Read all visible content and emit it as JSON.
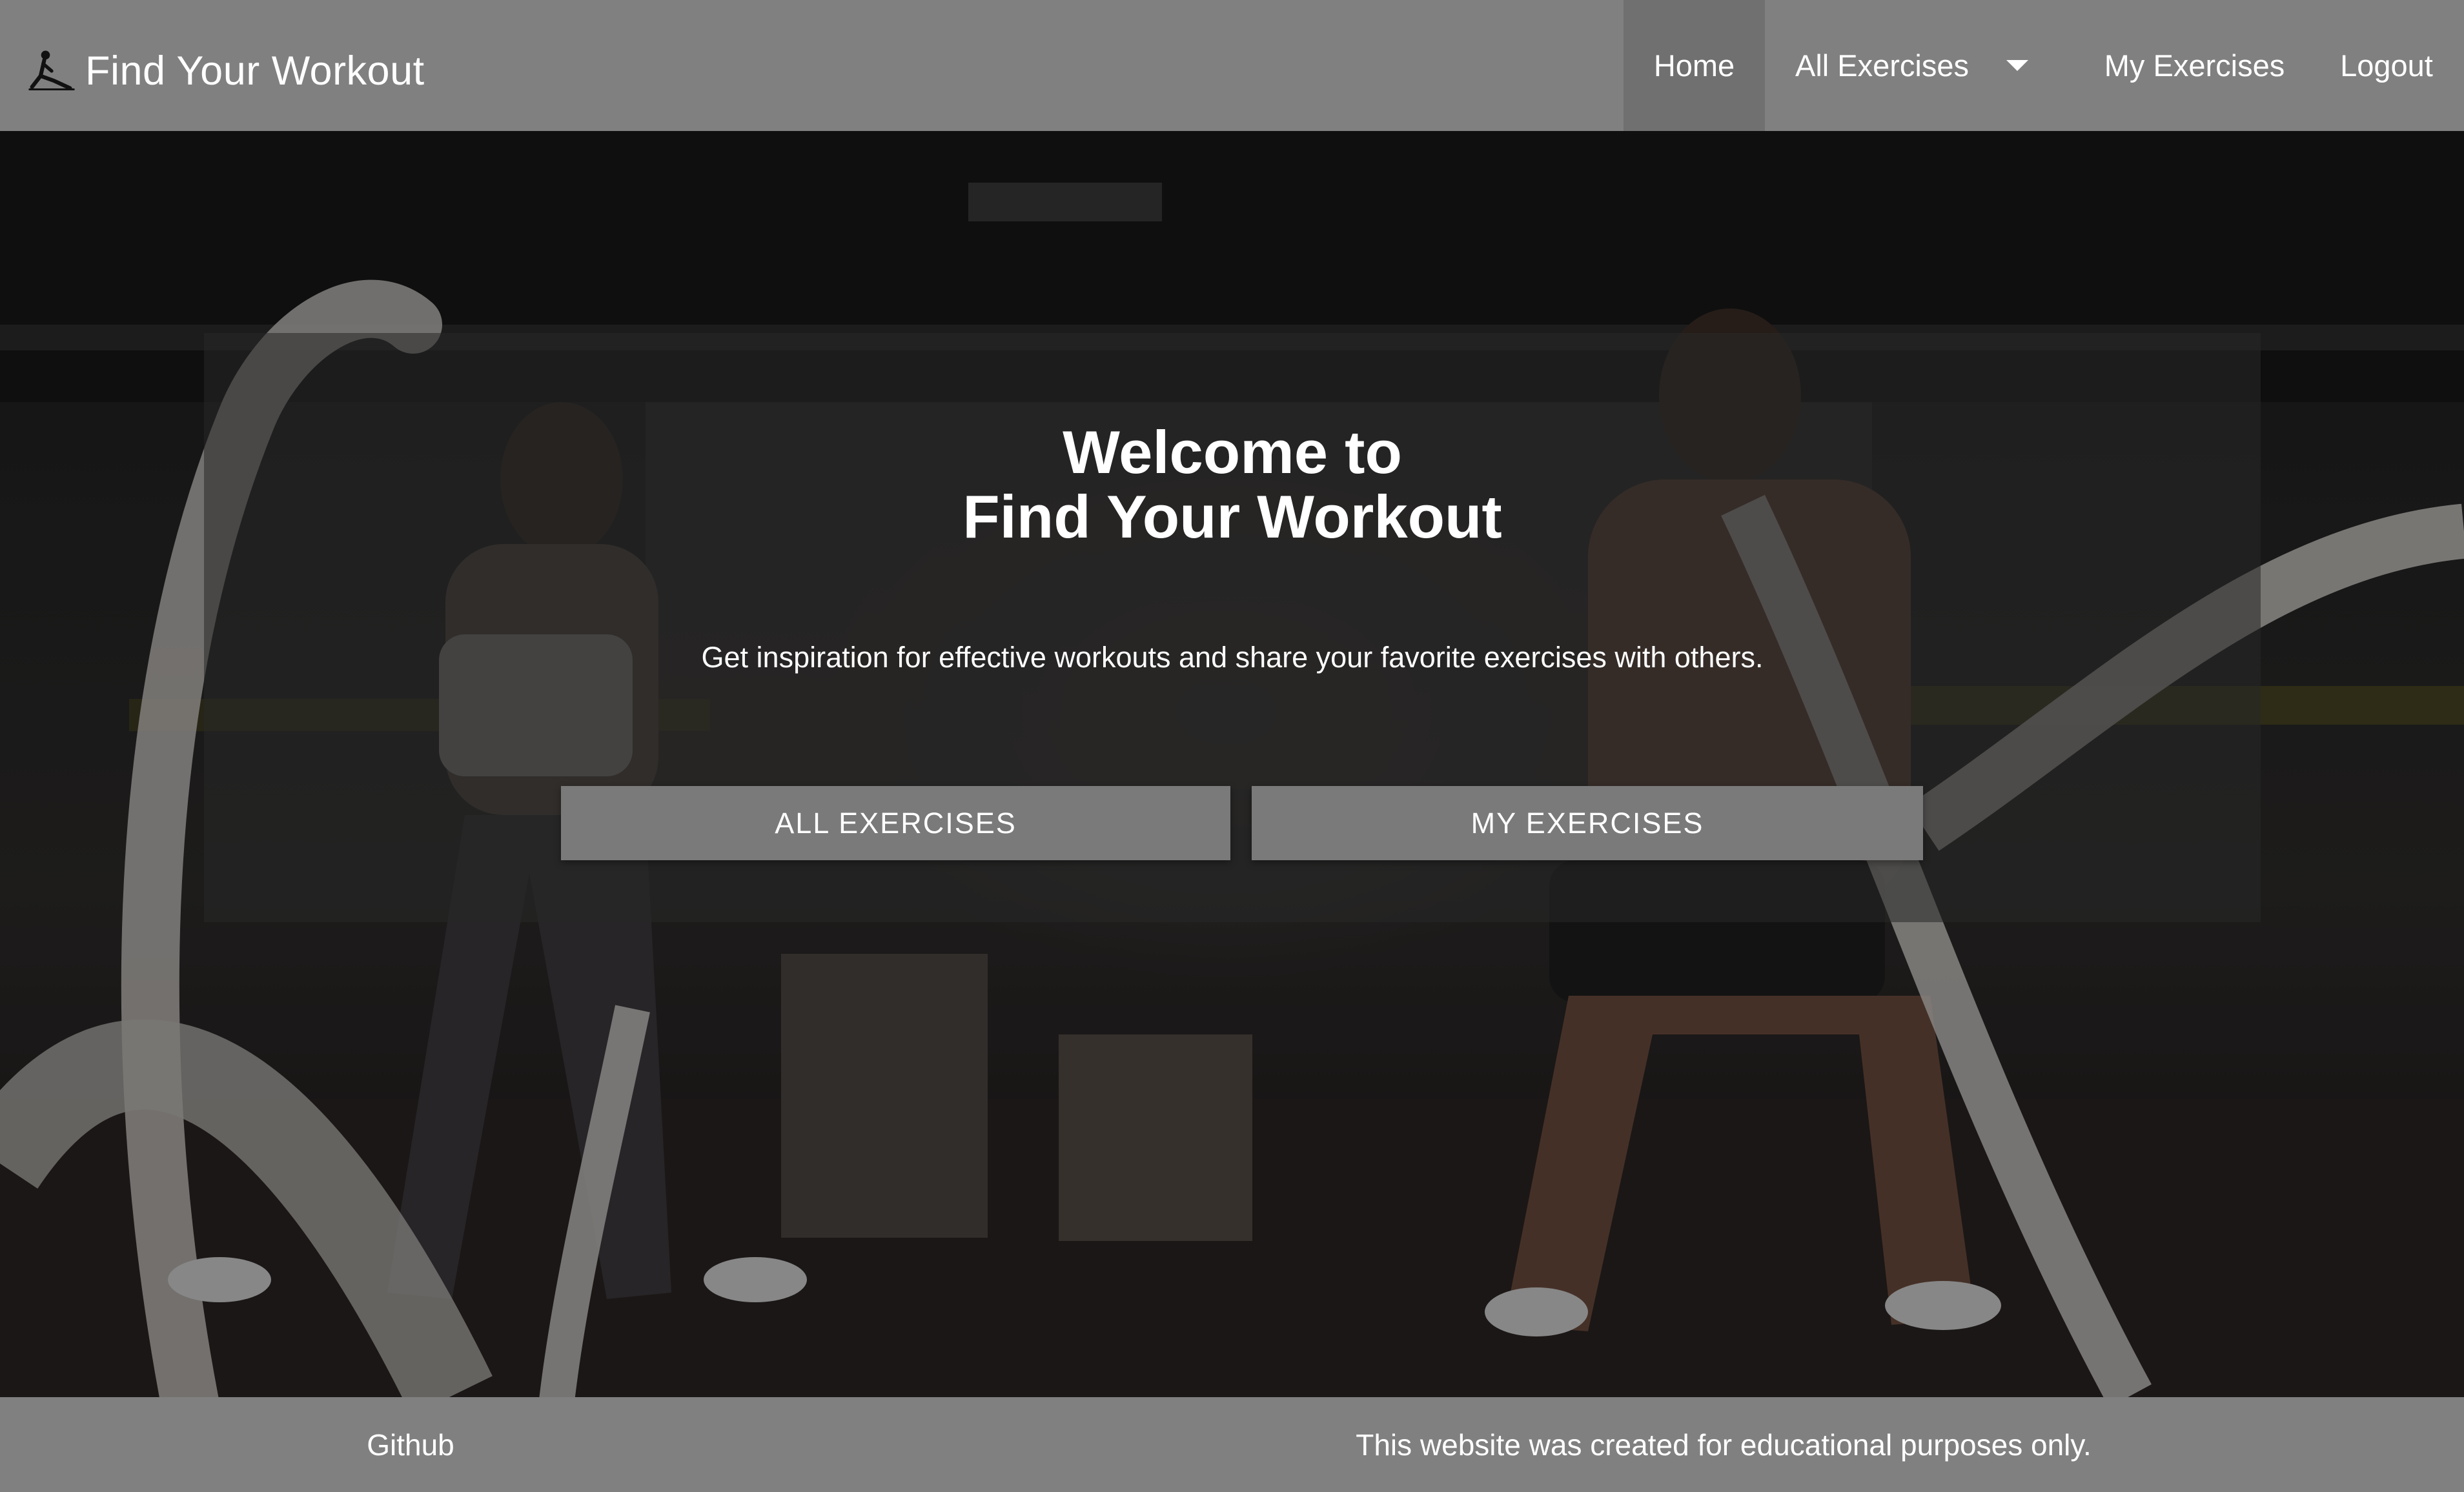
{
  "navbar": {
    "brand_name": "Find Your Workout",
    "brand_icon": "stretching-person-icon",
    "items": [
      {
        "label": "Home",
        "active": true
      },
      {
        "label": "All Exercises",
        "has_dropdown": true
      },
      {
        "label": "My Exercises"
      },
      {
        "label": "Logout"
      }
    ]
  },
  "hero": {
    "title_line1": "Welcome to",
    "title_line2": "Find Your Workout",
    "subtitle": "Get inspiration for effective workouts and share your favorite exercises with others.",
    "buttons": [
      {
        "label": "ALL EXERCISES"
      },
      {
        "label": "MY EXERCISES"
      }
    ]
  },
  "footer": {
    "link_label": "Github",
    "note": "This website was created for educational purposes only."
  },
  "colors": {
    "navbar_bg": "#808080",
    "nav_active_bg": "#707070",
    "button_bg": "#7a7a7a",
    "text": "#ffffff"
  }
}
